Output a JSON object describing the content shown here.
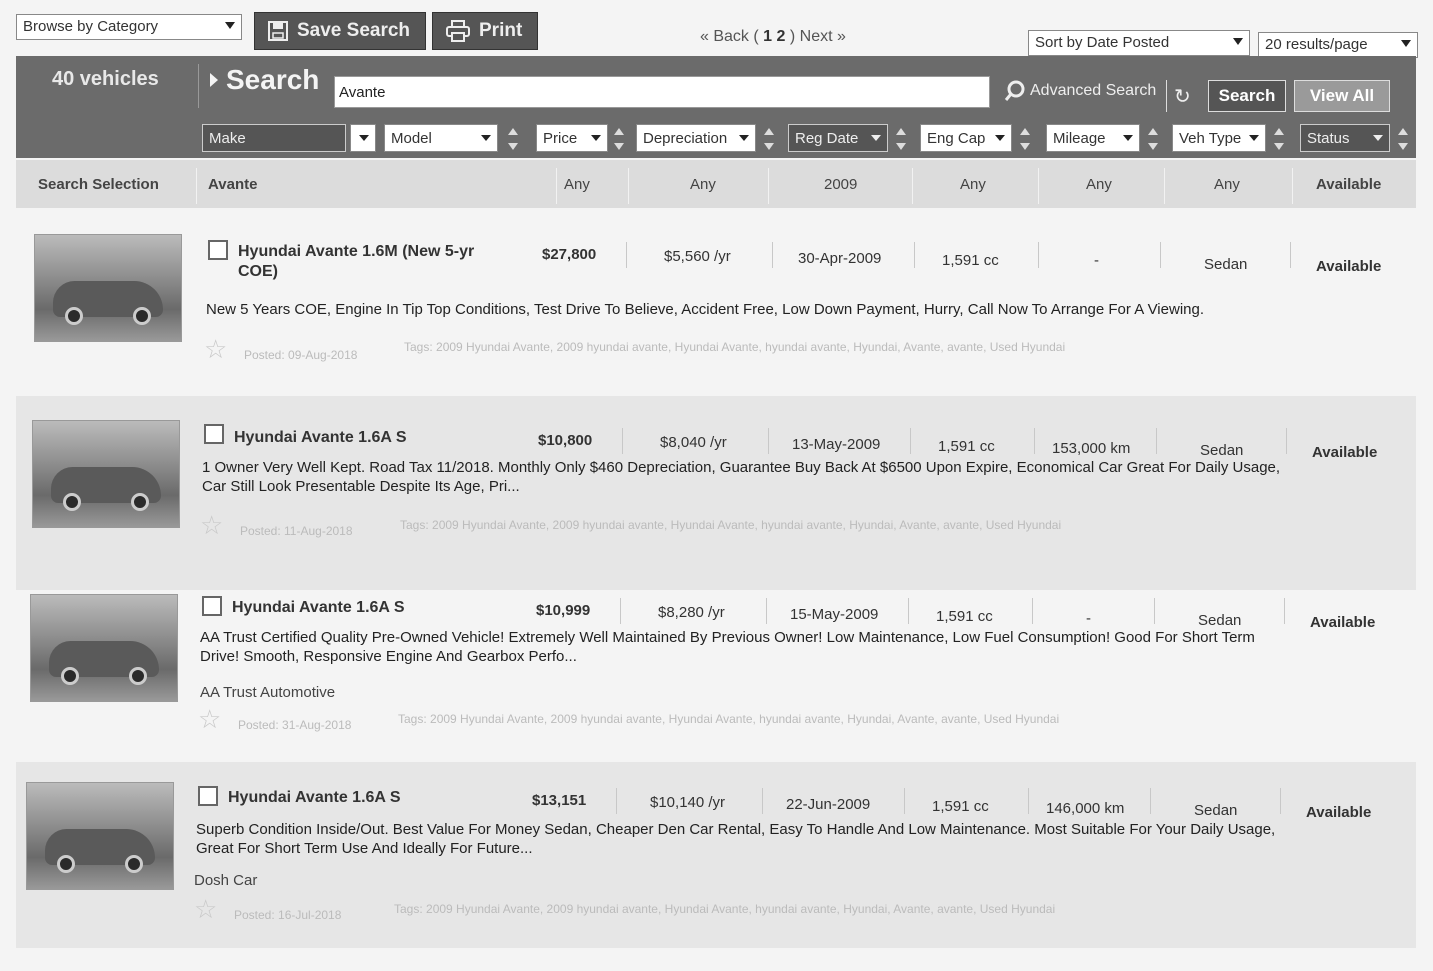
{
  "toolbar": {
    "category_select": "Browse by Category",
    "save_search": "Save Search",
    "print": "Print",
    "pager": {
      "back": "« Back",
      "open": "(",
      "page1": "1",
      "page2": "2",
      "close": ")",
      "next": "Next »"
    },
    "sort_select": "Sort by Date Posted",
    "per_page_select": "20 results/page"
  },
  "search": {
    "vehicle_count": "40 vehicles",
    "title": "Search",
    "query": "Avante",
    "advanced": "Advanced Search",
    "search_button": "Search",
    "view_all_button": "View All"
  },
  "filters": {
    "make": "Make",
    "model": "Model",
    "price": "Price",
    "depreciation": "Depreciation",
    "reg_date": "Reg Date",
    "eng_cap": "Eng Cap",
    "mileage": "Mileage",
    "veh_type": "Veh Type",
    "status": "Status"
  },
  "selection": {
    "label": "Search Selection",
    "model": "Avante",
    "price": "Any",
    "depreciation": "Any",
    "reg_date": "2009",
    "eng_cap": "Any",
    "mileage": "Any",
    "veh_type": "Any",
    "status": "Available"
  },
  "listings": [
    {
      "title": "Hyundai Avante 1.6M (New 5-yr COE)",
      "price": "$27,800",
      "depreciation": "$5,560 /yr",
      "reg_date": "30-Apr-2009",
      "eng_cap": "1,591 cc",
      "mileage": "-",
      "veh_type": "Sedan",
      "status": "Available",
      "description": "New 5 Years COE, Engine In Tip Top Conditions, Test Drive To Believe, Accident Free, Low Down Payment, Hurry, Call Now To Arrange For A Viewing.",
      "dealer": "",
      "posted": "Posted: 09-Aug-2018",
      "tags": "Tags: 2009 Hyundai Avante, 2009 hyundai avante, Hyundai Avante, hyundai avante, Hyundai, Avante, avante, Used Hyundai"
    },
    {
      "title": "Hyundai Avante 1.6A S",
      "price": "$10,800",
      "depreciation": "$8,040 /yr",
      "reg_date": "13-May-2009",
      "eng_cap": "1,591 cc",
      "mileage": "153,000 km",
      "veh_type": "Sedan",
      "status": "Available",
      "description": "1 Owner Very Well Kept. Road Tax 11/2018. Monthly Only $460 Depreciation, Guarantee Buy Back At $6500 Upon Expire, Economical Car Great For Daily Usage, Car Still Look Presentable Despite Its Age, Pri...",
      "dealer": "",
      "posted": "Posted: 11-Aug-2018",
      "tags": "Tags: 2009 Hyundai Avante, 2009 hyundai avante, Hyundai Avante, hyundai avante, Hyundai, Avante, avante, Used Hyundai"
    },
    {
      "title": "Hyundai Avante 1.6A S",
      "price": "$10,999",
      "depreciation": "$8,280 /yr",
      "reg_date": "15-May-2009",
      "eng_cap": "1,591 cc",
      "mileage": "-",
      "veh_type": "Sedan",
      "status": "Available",
      "description": "AA Trust Certified Quality Pre-Owned Vehicle! Extremely Well Maintained By Previous Owner! Low Maintenance, Low Fuel Consumption! Good For Short Term Drive! Smooth, Responsive Engine And Gearbox Perfo...",
      "dealer": "AA Trust Automotive",
      "posted": "Posted: 31-Aug-2018",
      "tags": "Tags: 2009 Hyundai Avante, 2009 hyundai avante, Hyundai Avante, hyundai avante, Hyundai, Avante, avante, Used Hyundai"
    },
    {
      "title": "Hyundai Avante 1.6A S",
      "price": "$13,151",
      "depreciation": "$10,140 /yr",
      "reg_date": "22-Jun-2009",
      "eng_cap": "1,591 cc",
      "mileage": "146,000 km",
      "veh_type": "Sedan",
      "status": "Available",
      "description": "Superb Condition Inside/Out. Best Value For Money Sedan, Cheaper Den Car Rental, Easy To Handle And Low Maintenance. Most Suitable For Your Daily Usage, Great For Short Term Use And Ideally For Future...",
      "dealer": "Dosh Car",
      "posted": "Posted: 16-Jul-2018",
      "tags": "Tags: 2009 Hyundai Avante, 2009 hyundai avante, Hyundai Avante, hyundai avante, Hyundai, Avante, avante, Used Hyundai"
    }
  ]
}
